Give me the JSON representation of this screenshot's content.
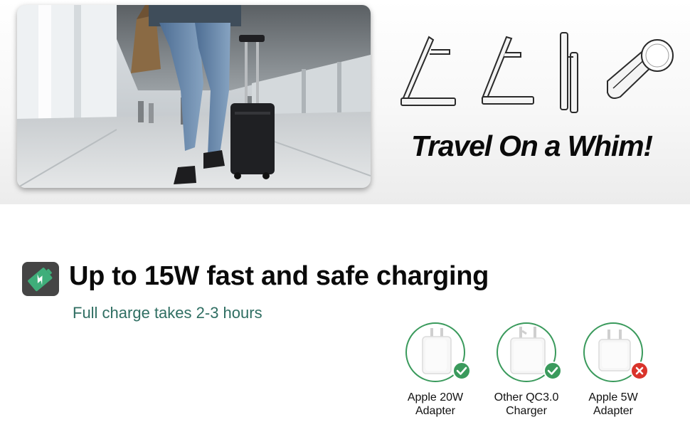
{
  "hero": {
    "photo_icon": "traveler-with-suitcase-photo",
    "stand_icons": [
      "stand-open-icon",
      "stand-tilted-icon",
      "stand-folding-icon",
      "stand-folded-with-pad-icon"
    ],
    "slogan": "Travel On a Whim!"
  },
  "charging": {
    "badge_icon": "battery-charging-icon",
    "headline": "Up to 15W fast and safe charging",
    "subline": "Full charge takes 2-3 hours",
    "adapters": [
      {
        "line1": "Apple 20W",
        "line2": "Adapter",
        "supported": true,
        "icon": "check-icon"
      },
      {
        "line1": "Other QC3.0",
        "line2": "Charger",
        "supported": true,
        "icon": "check-icon"
      },
      {
        "line1": "Apple 5W",
        "line2": "Adapter",
        "supported": false,
        "icon": "cross-icon"
      }
    ]
  },
  "colors": {
    "accent_green": "#3a9a5c",
    "subline_teal": "#2f6e62",
    "not_supported_red": "#d9342b",
    "badge_bg": "#454545"
  }
}
